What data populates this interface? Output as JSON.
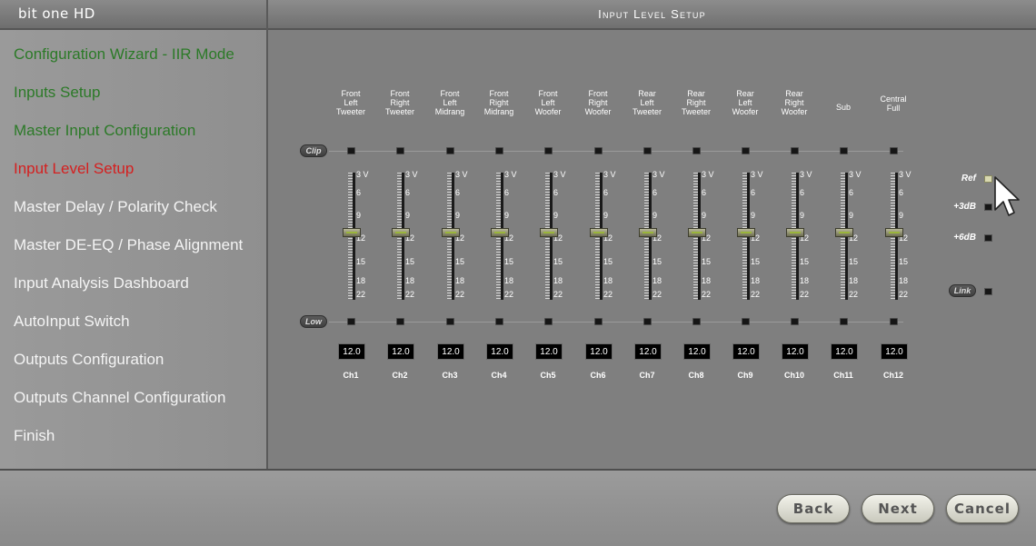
{
  "app": {
    "title": "bit one HD"
  },
  "header": {
    "title": "Input Level Setup"
  },
  "sidebar": {
    "items": [
      {
        "label": "Configuration Wizard - IIR Mode",
        "state": "done"
      },
      {
        "label": "Inputs Setup",
        "state": "done"
      },
      {
        "label": "Master Input Configuration",
        "state": "done"
      },
      {
        "label": "Input Level Setup",
        "state": "current"
      },
      {
        "label": "Master Delay / Polarity Check",
        "state": "todo"
      },
      {
        "label": "Master DE-EQ / Phase Alignment",
        "state": "todo"
      },
      {
        "label": "Input Analysis Dashboard",
        "state": "todo"
      },
      {
        "label": "AutoInput Switch",
        "state": "todo"
      },
      {
        "label": "Outputs Configuration",
        "state": "todo"
      },
      {
        "label": "Outputs Channel Configuration",
        "state": "todo"
      },
      {
        "label": "Finish",
        "state": "todo"
      }
    ]
  },
  "rows": {
    "clip_label": "Clip",
    "low_label": "Low"
  },
  "scale": {
    "top_label": "3 V",
    "marks": [
      "6",
      "9",
      "12",
      "15",
      "18",
      "22"
    ]
  },
  "channels": [
    {
      "label": "Front\nLeft\nTweeter",
      "value": "12.0",
      "name": "Ch1",
      "level_db": 12
    },
    {
      "label": "Front\nRight\nTweeter",
      "value": "12.0",
      "name": "Ch2",
      "level_db": 12
    },
    {
      "label": "Front\nLeft\nMidrang",
      "value": "12.0",
      "name": "Ch3",
      "level_db": 12
    },
    {
      "label": "Front\nRight\nMidrang",
      "value": "12.0",
      "name": "Ch4",
      "level_db": 12
    },
    {
      "label": "Front\nLeft\nWoofer",
      "value": "12.0",
      "name": "Ch5",
      "level_db": 12
    },
    {
      "label": "Front\nRight\nWoofer",
      "value": "12.0",
      "name": "Ch6",
      "level_db": 12
    },
    {
      "label": "Rear\nLeft\nTweeter",
      "value": "12.0",
      "name": "Ch7",
      "level_db": 12
    },
    {
      "label": "Rear\nRight\nTweeter",
      "value": "12.0",
      "name": "Ch8",
      "level_db": 12
    },
    {
      "label": "Rear\nLeft\nWoofer",
      "value": "12.0",
      "name": "Ch9",
      "level_db": 12
    },
    {
      "label": "Rear\nRight\nWoofer",
      "value": "12.0",
      "name": "Ch10",
      "level_db": 12
    },
    {
      "label": "Sub",
      "value": "12.0",
      "name": "Ch11",
      "level_db": 12
    },
    {
      "label": "Central\nFull",
      "value": "12.0",
      "name": "Ch12",
      "level_db": 12
    }
  ],
  "options": {
    "ref_label": "Ref",
    "plus3_label": "+3dB",
    "plus6_label": "+6dB",
    "link_label": "Link",
    "ref_active": true
  },
  "footer": {
    "back_label": "Back",
    "next_label": "Next",
    "cancel_label": "Cancel"
  },
  "colors": {
    "done": "#2c7a28",
    "current": "#d42020",
    "todo": "#f4f4f4"
  },
  "icons": {
    "pointer": "mouse-cursor-icon"
  }
}
